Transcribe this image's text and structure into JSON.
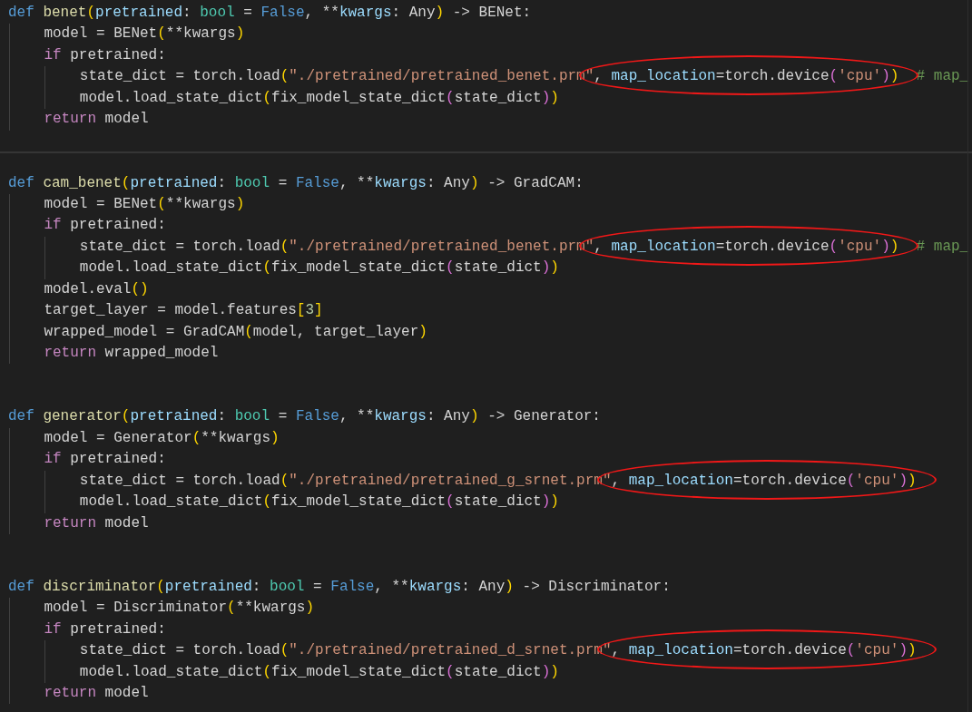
{
  "functions": [
    {
      "line": {
        "tokens": [
          {
            "kind": "storage",
            "text": "def"
          },
          {
            "kind": "function",
            "text": "benet"
          },
          {
            "kind": "bracket1",
            "text": "("
          },
          {
            "kind": "param",
            "text": "pretrained"
          },
          {
            "kind": "plain",
            "text": ": "
          },
          {
            "kind": "type",
            "text": "bool"
          },
          {
            "kind": "plain",
            "text": " = "
          },
          {
            "kind": "constant",
            "text": "False"
          },
          {
            "kind": "plain",
            "text": ", **"
          },
          {
            "kind": "param",
            "text": "kwargs"
          },
          {
            "kind": "plain",
            "text": ": Any"
          },
          {
            "kind": "bracket1",
            "text": ")"
          },
          {
            "kind": "plain",
            "text": " -> BENet:"
          }
        ],
        "children": [
          {
            "tokens": [
              {
                "kind": "plain",
                "text": "model = BENet"
              },
              {
                "kind": "bracket1",
                "text": "("
              },
              {
                "kind": "plain",
                "text": "**kwargs"
              },
              {
                "kind": "bracket1",
                "text": ")"
              }
            ]
          },
          {
            "tokens": [
              {
                "kind": "keyword",
                "text": "if"
              },
              {
                "kind": "plain",
                "text": " pretrained:"
              }
            ],
            "children": [
              {
                "tokens": [
                  {
                    "kind": "plain",
                    "text": "state_dict = torch.load"
                  },
                  {
                    "kind": "bracket1",
                    "text": "("
                  },
                  {
                    "kind": "string",
                    "text": "\"./pretrained/pretrained_benet.prm\""
                  }
                ],
                "circled": [
                  {
                    "kind": "plain",
                    "text": ", "
                  },
                  {
                    "kind": "param",
                    "text": "map_location"
                  },
                  {
                    "kind": "plain",
                    "text": "=torch.device"
                  },
                  {
                    "kind": "bracket2",
                    "text": "("
                  },
                  {
                    "kind": "string",
                    "text": "'cpu'"
                  },
                  {
                    "kind": "bracket2",
                    "text": ")"
                  },
                  {
                    "kind": "bracket1",
                    "text": ")"
                  }
                ],
                "trail": [
                  {
                    "kind": "comment",
                    "text": "# map_"
                  }
                ]
              },
              {
                "tokens": [
                  {
                    "kind": "plain",
                    "text": "model.load_state_dict"
                  },
                  {
                    "kind": "bracket1",
                    "text": "("
                  },
                  {
                    "kind": "plain",
                    "text": "fix_model_state_dict"
                  },
                  {
                    "kind": "bracket2",
                    "text": "("
                  },
                  {
                    "kind": "plain",
                    "text": "state_dict"
                  },
                  {
                    "kind": "bracket2",
                    "text": ")"
                  },
                  {
                    "kind": "bracket1",
                    "text": ")"
                  }
                ]
              }
            ]
          },
          {
            "tokens": [
              {
                "kind": "keyword",
                "text": "return"
              },
              {
                "kind": "plain",
                "text": " model"
              }
            ]
          }
        ]
      }
    },
    {
      "separator_above": true,
      "line": {
        "tokens": [
          {
            "kind": "storage",
            "text": "def"
          },
          {
            "kind": "function",
            "text": "cam_benet"
          },
          {
            "kind": "bracket1",
            "text": "("
          },
          {
            "kind": "param",
            "text": "pretrained"
          },
          {
            "kind": "plain",
            "text": ": "
          },
          {
            "kind": "type",
            "text": "bool"
          },
          {
            "kind": "plain",
            "text": " = "
          },
          {
            "kind": "constant",
            "text": "False"
          },
          {
            "kind": "plain",
            "text": ", **"
          },
          {
            "kind": "param",
            "text": "kwargs"
          },
          {
            "kind": "plain",
            "text": ": Any"
          },
          {
            "kind": "bracket1",
            "text": ")"
          },
          {
            "kind": "plain",
            "text": " -> GradCAM:"
          }
        ],
        "children": [
          {
            "tokens": [
              {
                "kind": "plain",
                "text": "model = BENet"
              },
              {
                "kind": "bracket1",
                "text": "("
              },
              {
                "kind": "plain",
                "text": "**kwargs"
              },
              {
                "kind": "bracket1",
                "text": ")"
              }
            ]
          },
          {
            "tokens": [
              {
                "kind": "keyword",
                "text": "if"
              },
              {
                "kind": "plain",
                "text": " pretrained:"
              }
            ],
            "children": [
              {
                "tokens": [
                  {
                    "kind": "plain",
                    "text": "state_dict = torch.load"
                  },
                  {
                    "kind": "bracket1",
                    "text": "("
                  },
                  {
                    "kind": "string",
                    "text": "\"./pretrained/pretrained_benet.prm\""
                  }
                ],
                "circled": [
                  {
                    "kind": "plain",
                    "text": ", "
                  },
                  {
                    "kind": "param",
                    "text": "map_location"
                  },
                  {
                    "kind": "plain",
                    "text": "=torch.device"
                  },
                  {
                    "kind": "bracket2",
                    "text": "("
                  },
                  {
                    "kind": "string",
                    "text": "'cpu'"
                  },
                  {
                    "kind": "bracket2",
                    "text": ")"
                  },
                  {
                    "kind": "bracket1",
                    "text": ")"
                  }
                ],
                "trail": [
                  {
                    "kind": "comment",
                    "text": "# map_"
                  }
                ]
              },
              {
                "tokens": [
                  {
                    "kind": "plain",
                    "text": "model.load_state_dict"
                  },
                  {
                    "kind": "bracket1",
                    "text": "("
                  },
                  {
                    "kind": "plain",
                    "text": "fix_model_state_dict"
                  },
                  {
                    "kind": "bracket2",
                    "text": "("
                  },
                  {
                    "kind": "plain",
                    "text": "state_dict"
                  },
                  {
                    "kind": "bracket2",
                    "text": ")"
                  },
                  {
                    "kind": "bracket1",
                    "text": ")"
                  }
                ]
              }
            ]
          },
          {
            "tokens": [
              {
                "kind": "plain",
                "text": "model.eval"
              },
              {
                "kind": "bracket1",
                "text": "()"
              }
            ]
          },
          {
            "tokens": [
              {
                "kind": "plain",
                "text": "target_layer = model.features"
              },
              {
                "kind": "bracket1",
                "text": "["
              },
              {
                "kind": "number",
                "text": "3"
              },
              {
                "kind": "bracket1",
                "text": "]"
              }
            ]
          },
          {
            "tokens": [
              {
                "kind": "plain",
                "text": "wrapped_model = GradCAM"
              },
              {
                "kind": "bracket1",
                "text": "("
              },
              {
                "kind": "plain",
                "text": "model, target_layer"
              },
              {
                "kind": "bracket1",
                "text": ")"
              }
            ]
          },
          {
            "tokens": [
              {
                "kind": "keyword",
                "text": "return"
              },
              {
                "kind": "plain",
                "text": " wrapped_model"
              }
            ]
          }
        ]
      }
    },
    {
      "line": {
        "tokens": [
          {
            "kind": "storage",
            "text": "def"
          },
          {
            "kind": "function",
            "text": "generator"
          },
          {
            "kind": "bracket1",
            "text": "("
          },
          {
            "kind": "param",
            "text": "pretrained"
          },
          {
            "kind": "plain",
            "text": ": "
          },
          {
            "kind": "type",
            "text": "bool"
          },
          {
            "kind": "plain",
            "text": " = "
          },
          {
            "kind": "constant",
            "text": "False"
          },
          {
            "kind": "plain",
            "text": ", **"
          },
          {
            "kind": "param",
            "text": "kwargs"
          },
          {
            "kind": "plain",
            "text": ": Any"
          },
          {
            "kind": "bracket1",
            "text": ")"
          },
          {
            "kind": "plain",
            "text": " -> Generator:"
          }
        ],
        "children": [
          {
            "tokens": [
              {
                "kind": "plain",
                "text": "model = Generator"
              },
              {
                "kind": "bracket1",
                "text": "("
              },
              {
                "kind": "plain",
                "text": "**kwargs"
              },
              {
                "kind": "bracket1",
                "text": ")"
              }
            ]
          },
          {
            "tokens": [
              {
                "kind": "keyword",
                "text": "if"
              },
              {
                "kind": "plain",
                "text": " pretrained:"
              }
            ],
            "children": [
              {
                "tokens": [
                  {
                    "kind": "plain",
                    "text": "state_dict = torch.load"
                  },
                  {
                    "kind": "bracket1",
                    "text": "("
                  },
                  {
                    "kind": "string",
                    "text": "\"./pretrained/pretrained_g_srnet.prm\""
                  }
                ],
                "circled": [
                  {
                    "kind": "plain",
                    "text": ", "
                  },
                  {
                    "kind": "param",
                    "text": "map_location"
                  },
                  {
                    "kind": "plain",
                    "text": "=torch.device"
                  },
                  {
                    "kind": "bracket2",
                    "text": "("
                  },
                  {
                    "kind": "string",
                    "text": "'cpu'"
                  },
                  {
                    "kind": "bracket2",
                    "text": ")"
                  },
                  {
                    "kind": "bracket1",
                    "text": ")"
                  }
                ]
              },
              {
                "tokens": [
                  {
                    "kind": "plain",
                    "text": "model.load_state_dict"
                  },
                  {
                    "kind": "bracket1",
                    "text": "("
                  },
                  {
                    "kind": "plain",
                    "text": "fix_model_state_dict"
                  },
                  {
                    "kind": "bracket2",
                    "text": "("
                  },
                  {
                    "kind": "plain",
                    "text": "state_dict"
                  },
                  {
                    "kind": "bracket2",
                    "text": ")"
                  },
                  {
                    "kind": "bracket1",
                    "text": ")"
                  }
                ]
              }
            ]
          },
          {
            "tokens": [
              {
                "kind": "keyword",
                "text": "return"
              },
              {
                "kind": "plain",
                "text": " model"
              }
            ]
          }
        ]
      }
    },
    {
      "line": {
        "tokens": [
          {
            "kind": "storage",
            "text": "def"
          },
          {
            "kind": "function",
            "text": "discriminator"
          },
          {
            "kind": "bracket1",
            "text": "("
          },
          {
            "kind": "param",
            "text": "pretrained"
          },
          {
            "kind": "plain",
            "text": ": "
          },
          {
            "kind": "type",
            "text": "bool"
          },
          {
            "kind": "plain",
            "text": " = "
          },
          {
            "kind": "constant",
            "text": "False"
          },
          {
            "kind": "plain",
            "text": ", **"
          },
          {
            "kind": "param",
            "text": "kwargs"
          },
          {
            "kind": "plain",
            "text": ": Any"
          },
          {
            "kind": "bracket1",
            "text": ")"
          },
          {
            "kind": "plain",
            "text": " -> Discriminator:"
          }
        ],
        "children": [
          {
            "tokens": [
              {
                "kind": "plain",
                "text": "model = Discriminator"
              },
              {
                "kind": "bracket1",
                "text": "("
              },
              {
                "kind": "plain",
                "text": "**kwargs"
              },
              {
                "kind": "bracket1",
                "text": ")"
              }
            ]
          },
          {
            "tokens": [
              {
                "kind": "keyword",
                "text": "if"
              },
              {
                "kind": "plain",
                "text": " pretrained:"
              }
            ],
            "children": [
              {
                "tokens": [
                  {
                    "kind": "plain",
                    "text": "state_dict = torch.load"
                  },
                  {
                    "kind": "bracket1",
                    "text": "("
                  },
                  {
                    "kind": "string",
                    "text": "\"./pretrained/pretrained_d_srnet.prm\""
                  }
                ],
                "circled": [
                  {
                    "kind": "plain",
                    "text": ", "
                  },
                  {
                    "kind": "param",
                    "text": "map_location"
                  },
                  {
                    "kind": "plain",
                    "text": "=torch.device"
                  },
                  {
                    "kind": "bracket2",
                    "text": "("
                  },
                  {
                    "kind": "string",
                    "text": "'cpu'"
                  },
                  {
                    "kind": "bracket2",
                    "text": ")"
                  },
                  {
                    "kind": "bracket1",
                    "text": ")"
                  }
                ]
              },
              {
                "tokens": [
                  {
                    "kind": "plain",
                    "text": "model.load_state_dict"
                  },
                  {
                    "kind": "bracket1",
                    "text": "("
                  },
                  {
                    "kind": "plain",
                    "text": "fix_model_state_dict"
                  },
                  {
                    "kind": "bracket2",
                    "text": "("
                  },
                  {
                    "kind": "plain",
                    "text": "state_dict"
                  },
                  {
                    "kind": "bracket2",
                    "text": ")"
                  },
                  {
                    "kind": "bracket1",
                    "text": ")"
                  }
                ]
              }
            ]
          },
          {
            "tokens": [
              {
                "kind": "keyword",
                "text": "return"
              },
              {
                "kind": "plain",
                "text": " model"
              }
            ]
          }
        ]
      }
    }
  ]
}
